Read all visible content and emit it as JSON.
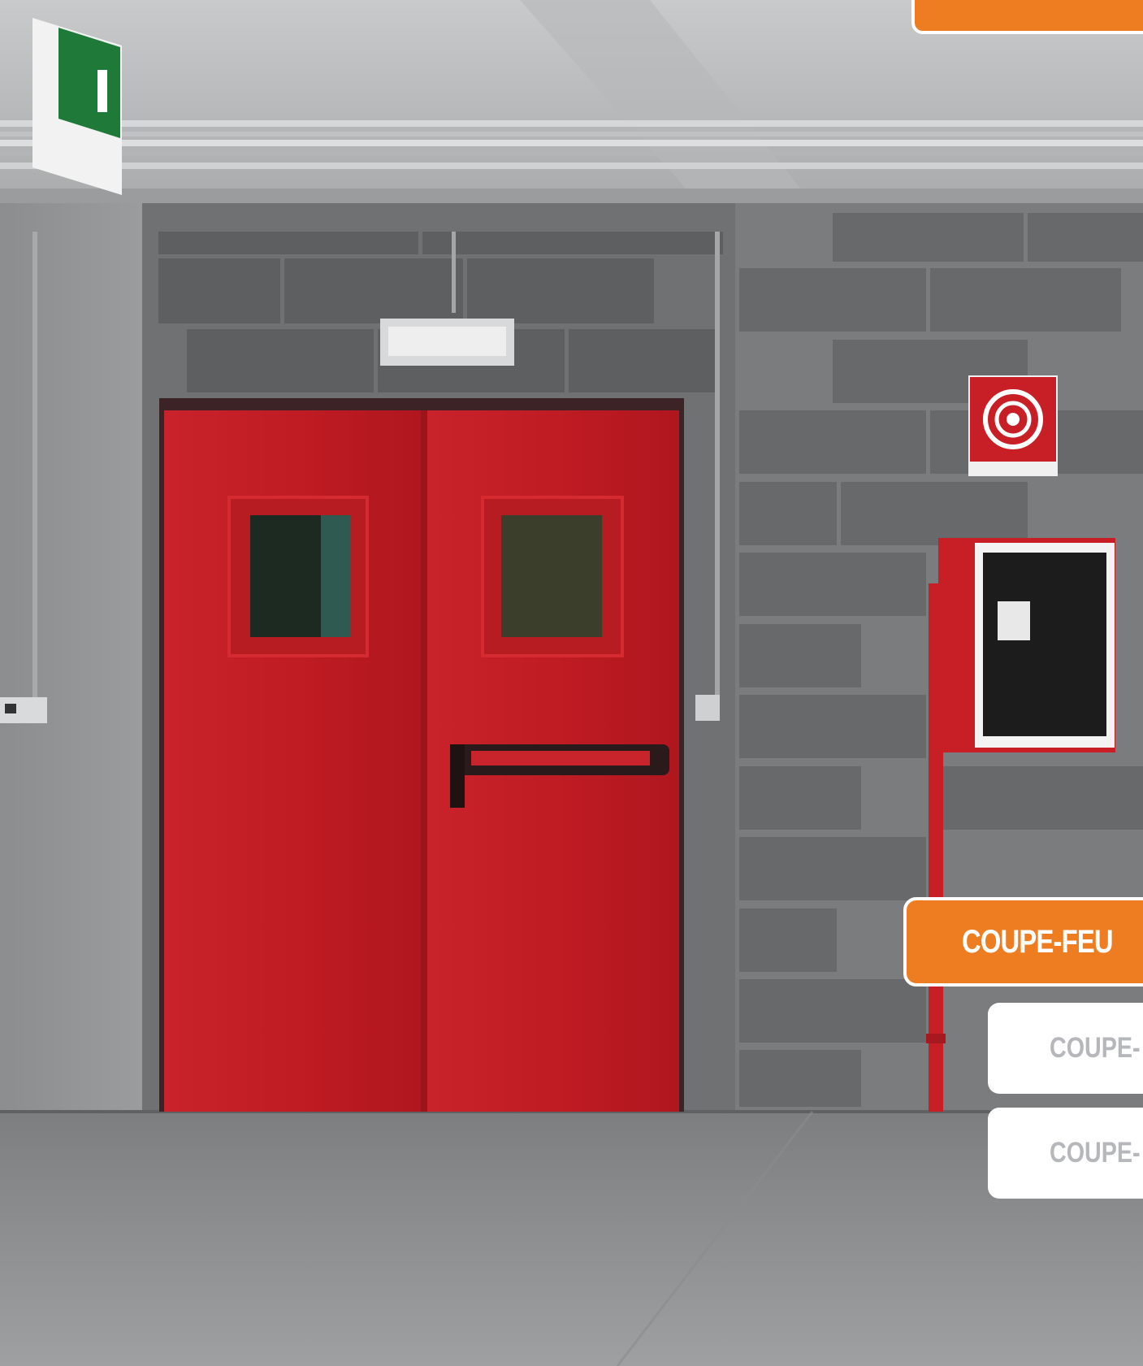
{
  "tabs": [
    {
      "label": "COUPE-FEU",
      "state": "active"
    },
    {
      "label": "COUPE-",
      "state": "inactive"
    },
    {
      "label": "COUPE-",
      "state": "inactive"
    }
  ],
  "colors": {
    "accent_orange": "#ee7d22",
    "door_red": "#c11d22",
    "inactive_text": "#b5b7ba"
  },
  "icons": [
    "emergency-exit-sign-icon",
    "fire-hose-sign-icon"
  ]
}
